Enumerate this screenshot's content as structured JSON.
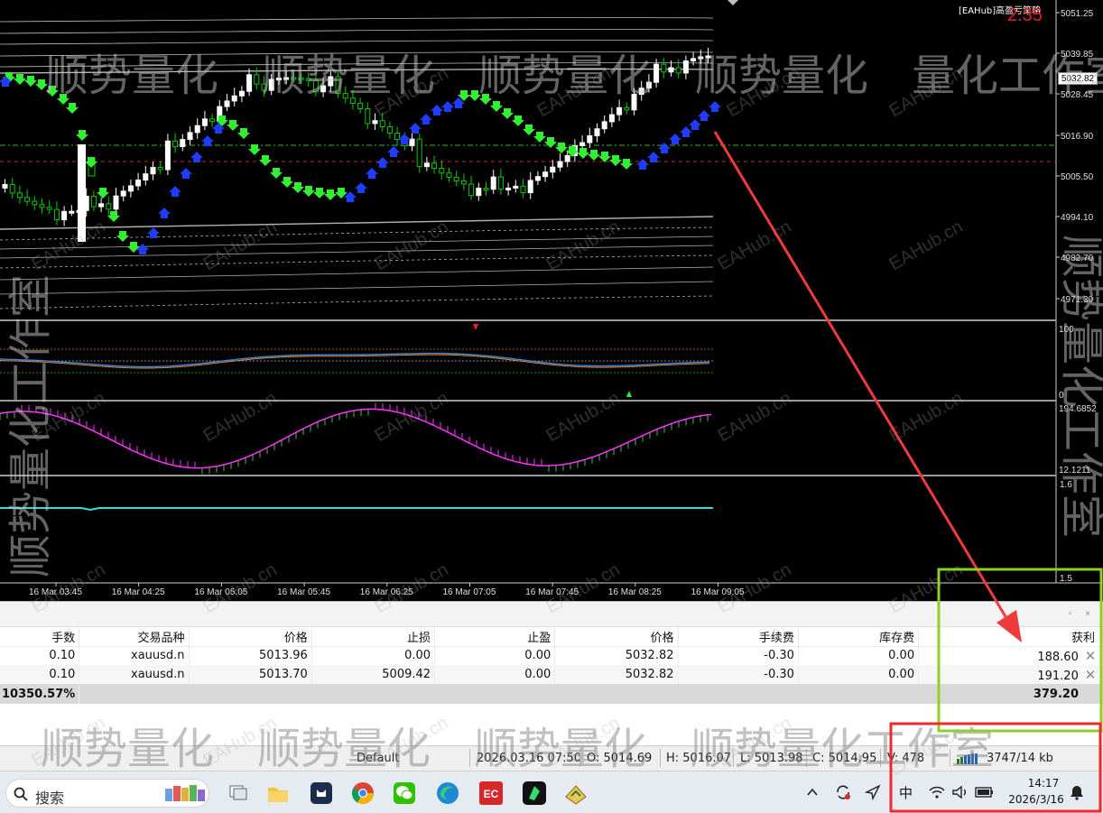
{
  "chart": {
    "ea_label": "[EAHub]高盈亏策略",
    "timer": "2:35",
    "current_price": "5032.82",
    "price_axis": [
      "5051.25",
      "5039.85",
      "5028.45",
      "5016.90",
      "5005.50",
      "4994.10",
      "4982.70",
      "4971.30"
    ],
    "rsi_axis": [
      "100",
      "0"
    ],
    "osc_axis": [
      "194.6852",
      "12.1211"
    ],
    "bottom_axis": [
      "1.6",
      "1.5"
    ],
    "time_labels": [
      "16 Mar 03:45",
      "16 Mar 04:25",
      "16 Mar 05:05",
      "16 Mar 05:45",
      "16 Mar 06:25",
      "16 Mar 07:05",
      "16 Mar 07:45",
      "16 Mar 08:25",
      "16 Mar 09:05"
    ],
    "colors": {
      "up_arrow": "#1f3cff",
      "down_arrow": "#33ee33",
      "bull_candle": "#ffffff",
      "bear_candle": "#00cc00",
      "green_level": "#2bbd2b",
      "red_level": "#cc2222",
      "macd_line": "#ff33ff",
      "hline": "#33dddd"
    }
  },
  "trade_table": {
    "headers": [
      "手数",
      "交易品种",
      "价格",
      "止损",
      "止盈",
      "价格",
      "手续费",
      "库存费",
      "获利"
    ],
    "rows": [
      [
        "0.10",
        "xauusd.n",
        "5013.96",
        "0.00",
        "0.00",
        "5032.82",
        "-0.30",
        "0.00",
        "188.60"
      ],
      [
        "0.10",
        "xauusd.n",
        "5013.70",
        "5009.42",
        "0.00",
        "5032.82",
        "-0.30",
        "0.00",
        "191.20"
      ]
    ],
    "summary_left": "10350.57%",
    "summary_profit": "379.20"
  },
  "status_bar": {
    "profile": "Default",
    "datetime": "2026.03.16 07:50",
    "open": "O: 5014.69",
    "high": "H: 5016.07",
    "low": "L: 5013.98",
    "close": "C: 5014.95",
    "volume": "V: 478",
    "traffic": "3747/14 kb"
  },
  "taskbar": {
    "search_label": "搜索",
    "ime": "中",
    "time": "14:17",
    "date": "2026/3/16",
    "apps": [
      "task-view-icon",
      "file-explorer-icon",
      "cat-app-icon",
      "chrome-icon",
      "wechat-icon",
      "edge-icon",
      "ec-app-icon",
      "green-app-icon",
      "stock-app-icon"
    ]
  },
  "watermarks": {
    "main_text": "顺势量化工作室",
    "site_text": "EAHub.cn"
  }
}
